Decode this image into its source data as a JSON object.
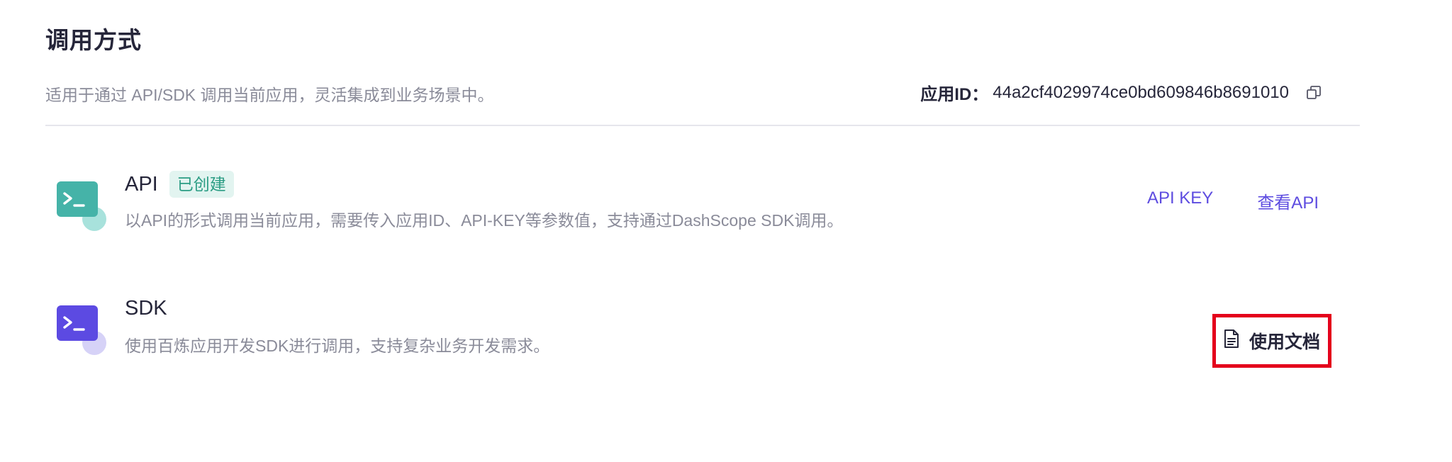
{
  "section": {
    "title": "调用方式",
    "description": "适用于通过 API/SDK 调用当前应用，灵活集成到业务场景中。",
    "app_id_label": "应用ID：",
    "app_id_value": "44a2cf4029974ce0bd609846b8691010",
    "copy_icon": "copy-icon"
  },
  "rows": [
    {
      "name": "API",
      "badge": "已创建",
      "description": "以API的形式调用当前应用，需要传入应用ID、API-KEY等参数值，支持通过DashScope SDK调用。",
      "icon": "terminal-icon",
      "accent": "#45b3a8",
      "actions": [
        "API KEY",
        "查看API"
      ]
    },
    {
      "name": "SDK",
      "description": "使用百炼应用开发SDK进行调用，支持复杂业务开发需求。",
      "icon": "terminal-icon",
      "accent": "#5c4ae2",
      "doc_button": "使用文档",
      "doc_icon": "document-icon"
    }
  ],
  "colors": {
    "link": "#5d4ce0",
    "badge_bg": "#e2f4f0",
    "badge_text": "#2b9d84",
    "highlight_border": "#e4001b"
  }
}
